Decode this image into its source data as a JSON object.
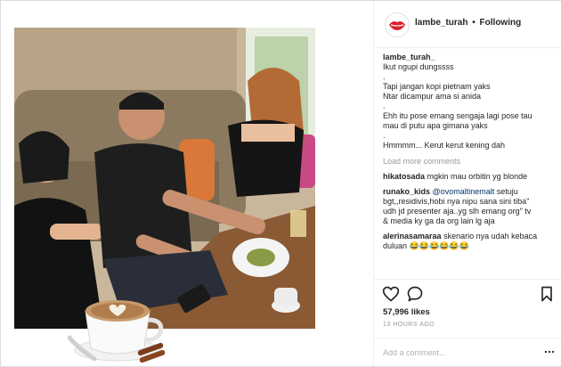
{
  "header": {
    "username": "lambe_turah",
    "separator": "•",
    "follow_label": "Following"
  },
  "caption": {
    "username": "lambe_turah_",
    "lines": [
      "Ikut ngupi dungssss",
      ".",
      "Tapi jangan kopi pietnam yaks",
      "Ntar dicampur ama si anida",
      ".",
      "Ehh itu pose emang sengaja lagi pose tau",
      "mau di putu apa gimana yaks",
      ".",
      "Hmmmm... Kerut kerut kening dah"
    ]
  },
  "load_more_label": "Load more comments",
  "comments": [
    {
      "user": "hikatosada",
      "lines": [
        "mgkin mau orbitin yg blonde"
      ]
    },
    {
      "user": "runako_kids",
      "mention": "@ovomaltinemalt",
      "first_rest": "setuju",
      "lines": [
        "bgt,,residivis,hobi nya nipu sana sini tiba\"",
        "udh jd presenter aja..yg slh emang org\" tv",
        "& media ky ga da org lain lg aja"
      ]
    },
    {
      "user": "alerinasamaraa",
      "first_rest": "skenario nya udah kebaca",
      "lines": [
        "duluan 😂😂😂😂😂😂"
      ]
    }
  ],
  "icons": {
    "like": "heart-icon",
    "comment": "comment-bubble-icon",
    "save": "bookmark-icon",
    "more": "more-options-icon"
  },
  "likes_text": "57,996 likes",
  "timestamp": "13 HOURS AGO",
  "add_comment": {
    "placeholder": "Add a comment...",
    "value": ""
  },
  "colors": {
    "username_link": "#262626",
    "muted": "#999999",
    "mention": "#003569",
    "avatar_lips": "#e0202e"
  }
}
